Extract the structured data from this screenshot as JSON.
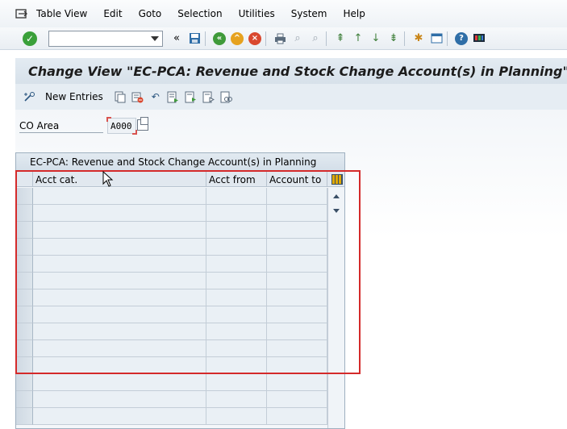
{
  "menu": {
    "items": [
      "Table View",
      "Edit",
      "Goto",
      "Selection",
      "Utilities",
      "System",
      "Help"
    ]
  },
  "toolbar": {
    "command_field_value": ""
  },
  "title": "Change View \"EC-PCA: Revenue and Stock Change Account(s) in Planning\":",
  "app_toolbar": {
    "new_entries_label": "New Entries"
  },
  "co_area": {
    "label": "CO Area",
    "value": "A000"
  },
  "table": {
    "title": "EC-PCA: Revenue and Stock Change Account(s) in Planning",
    "columns": [
      "Acct cat.",
      "Acct from",
      "Account to"
    ],
    "row_count": 14
  },
  "colors": {
    "highlight": "#d42a2a",
    "ok_green": "#3aa03a"
  }
}
